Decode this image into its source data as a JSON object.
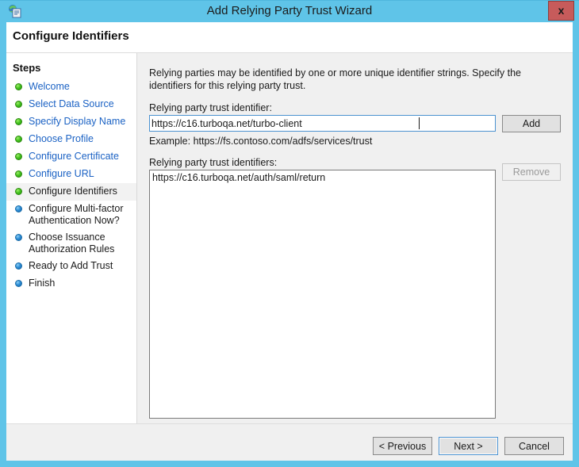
{
  "window": {
    "title": "Add Relying Party Trust Wizard",
    "icon": "certificate-globe-icon",
    "close_label": "x",
    "accent_color": "#5fc4e8",
    "close_color": "#c75b5b"
  },
  "header": {
    "title": "Configure Identifiers"
  },
  "sidebar": {
    "heading": "Steps",
    "items": [
      {
        "label": "Welcome",
        "state": "done",
        "bullet": "green-bullet-icon"
      },
      {
        "label": "Select Data Source",
        "state": "done",
        "bullet": "green-bullet-icon"
      },
      {
        "label": "Specify Display Name",
        "state": "done",
        "bullet": "green-bullet-icon"
      },
      {
        "label": "Choose Profile",
        "state": "done",
        "bullet": "green-bullet-icon"
      },
      {
        "label": "Configure Certificate",
        "state": "done",
        "bullet": "green-bullet-icon"
      },
      {
        "label": "Configure URL",
        "state": "done",
        "bullet": "green-bullet-icon"
      },
      {
        "label": "Configure Identifiers",
        "state": "current",
        "bullet": "green-bullet-icon"
      },
      {
        "label": "Configure Multi-factor Authentication Now?",
        "state": "pending",
        "bullet": "blue-bullet-icon"
      },
      {
        "label": "Choose Issuance Authorization Rules",
        "state": "pending",
        "bullet": "blue-bullet-icon"
      },
      {
        "label": "Ready to Add Trust",
        "state": "pending",
        "bullet": "blue-bullet-icon"
      },
      {
        "label": "Finish",
        "state": "pending",
        "bullet": "blue-bullet-icon"
      }
    ]
  },
  "main": {
    "intro": "Relying parties may be identified by one or more unique identifier strings. Specify the identifiers for this relying party trust.",
    "identifier_label": "Relying party trust identifier:",
    "identifier_value": "https://c16.turboqa.net/turbo-client",
    "identifier_placeholder": "",
    "add_label": "Add",
    "example": "Example: https://fs.contoso.com/adfs/services/trust",
    "identifiers_label": "Relying party trust identifiers:",
    "remove_label": "Remove",
    "remove_enabled": false,
    "identifiers": [
      "https://c16.turboqa.net/auth/saml/return"
    ]
  },
  "footer": {
    "previous_label": "< Previous",
    "next_label": "Next >",
    "cancel_label": "Cancel"
  }
}
